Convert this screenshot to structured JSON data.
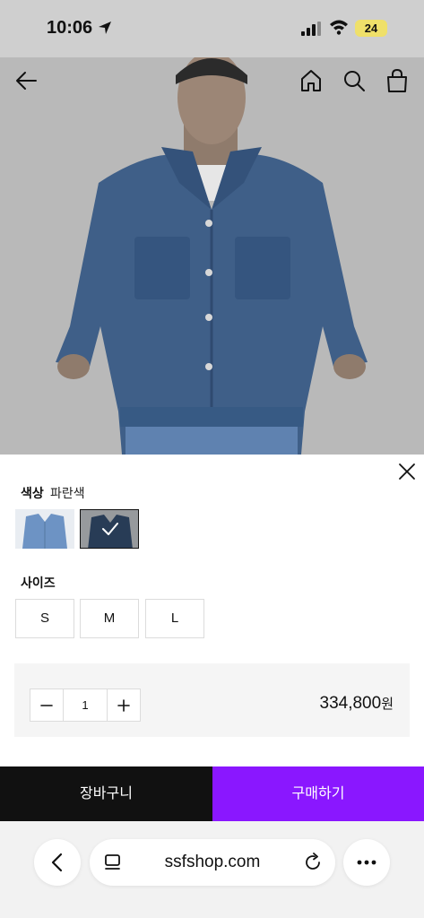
{
  "status_bar": {
    "time": "10:06",
    "battery": "24"
  },
  "top_nav": {
    "icons": [
      "back-arrow-icon",
      "home-icon",
      "search-icon",
      "shopping-bag-icon"
    ]
  },
  "options": {
    "color_label": "색상",
    "color_value": "파란색",
    "size_label": "사이즈",
    "sizes": [
      "S",
      "M",
      "L"
    ]
  },
  "purchase": {
    "quantity": "1",
    "price": "334,800",
    "currency": "원"
  },
  "actions": {
    "cart_label": "장바구니",
    "buy_label": "구매하기"
  },
  "browser": {
    "url": "ssfshop.com"
  },
  "colors": {
    "buy_accent": "#8a17ff",
    "cart_bg": "#111111"
  }
}
